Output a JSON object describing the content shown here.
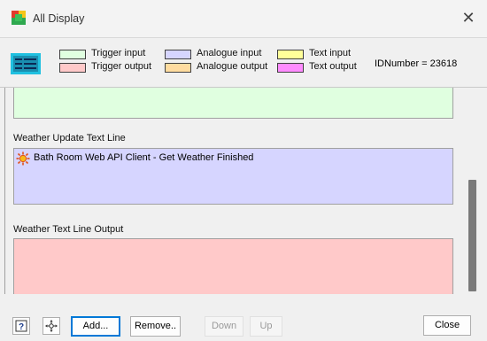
{
  "window": {
    "title": "All Display"
  },
  "legend": {
    "items": [
      {
        "label": "Trigger input",
        "color": "#e0ffe0"
      },
      {
        "label": "Trigger output",
        "color": "#ffc9c9"
      },
      {
        "label": "Analogue input",
        "color": "#d6d5ff"
      },
      {
        "label": "Analogue output",
        "color": "#ffdca0"
      },
      {
        "label": "Text input",
        "color": "#ffff99"
      },
      {
        "label": "Text output",
        "color": "#ff8cff"
      }
    ],
    "id_number": "IDNumber = 23618"
  },
  "sections": [
    {
      "label": "Weather Update Text Line",
      "entries": [
        {
          "text": "Bath Room Web API Client - Get Weather Finished",
          "icon": "sun-icon"
        }
      ]
    },
    {
      "label": "Weather Text Line Output",
      "entries": []
    }
  ],
  "buttons": {
    "help_icon": "question-icon",
    "move_icon": "move-icon",
    "add": "Add...",
    "remove": "Remove..",
    "down": "Down",
    "up": "Up",
    "close": "Close"
  }
}
